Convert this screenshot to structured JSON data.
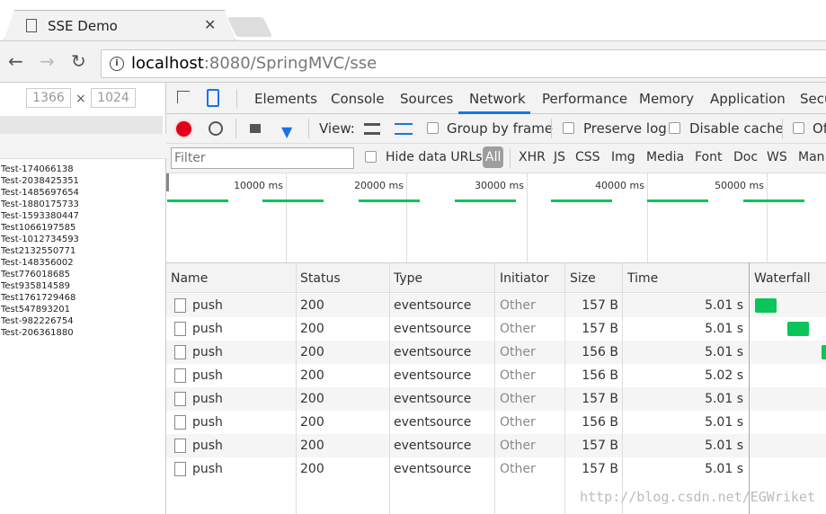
{
  "browser": {
    "tab_title": "SSE Demo",
    "url_host": "localhost",
    "url_rest": ":8080/SpringMVC/sse"
  },
  "device": {
    "width": "1366",
    "times": "×",
    "height": "1024"
  },
  "messages": [
    "Test-174066138",
    "Test-2038425351",
    "Test-1485697654",
    "Test-1880175733",
    "Test-1593380447",
    "Test1066197585",
    "Test-1012734593",
    "Test2132550771",
    "Test-148356002",
    "Test776018685",
    "Test935814589",
    "Test1761729468",
    "Test547893201",
    "Test-982226754",
    "Test-206361880"
  ],
  "devtools": {
    "tabs": [
      "Elements",
      "Console",
      "Sources",
      "Network",
      "Performance",
      "Memory",
      "Application",
      "Secu"
    ],
    "active_tab": "Network",
    "toolbar": {
      "view_label": "View:",
      "group_by_frame": "Group by frame",
      "preserve_log": "Preserve log",
      "disable_cache": "Disable cache",
      "offline": "Of"
    },
    "filter": {
      "placeholder": "Filter",
      "hide_data_urls": "Hide data URLs",
      "types": [
        "All",
        "XHR",
        "JS",
        "CSS",
        "Img",
        "Media",
        "Font",
        "Doc",
        "WS",
        "Man"
      ]
    },
    "overview_ticks": [
      "10000 ms",
      "20000 ms",
      "30000 ms",
      "40000 ms",
      "50000 ms"
    ],
    "columns": [
      "Name",
      "Status",
      "Type",
      "Initiator",
      "Size",
      "Time",
      "Waterfall"
    ],
    "requests": [
      {
        "name": "push",
        "status": "200",
        "type": "eventsource",
        "initiator": "Other",
        "size": "157 B",
        "time": "5.01 s"
      },
      {
        "name": "push",
        "status": "200",
        "type": "eventsource",
        "initiator": "Other",
        "size": "157 B",
        "time": "5.01 s"
      },
      {
        "name": "push",
        "status": "200",
        "type": "eventsource",
        "initiator": "Other",
        "size": "156 B",
        "time": "5.01 s"
      },
      {
        "name": "push",
        "status": "200",
        "type": "eventsource",
        "initiator": "Other",
        "size": "156 B",
        "time": "5.02 s"
      },
      {
        "name": "push",
        "status": "200",
        "type": "eventsource",
        "initiator": "Other",
        "size": "157 B",
        "time": "5.01 s"
      },
      {
        "name": "push",
        "status": "200",
        "type": "eventsource",
        "initiator": "Other",
        "size": "156 B",
        "time": "5.01 s"
      },
      {
        "name": "push",
        "status": "200",
        "type": "eventsource",
        "initiator": "Other",
        "size": "157 B",
        "time": "5.01 s"
      },
      {
        "name": "push",
        "status": "200",
        "type": "eventsource",
        "initiator": "Other",
        "size": "157 B",
        "time": "5.01 s"
      }
    ],
    "colors": {
      "accent": "#1a73e8",
      "record": "#e0001b",
      "waterfall": "#0bc45a"
    }
  },
  "watermark": "http://blog.csdn.net/EGWriket"
}
